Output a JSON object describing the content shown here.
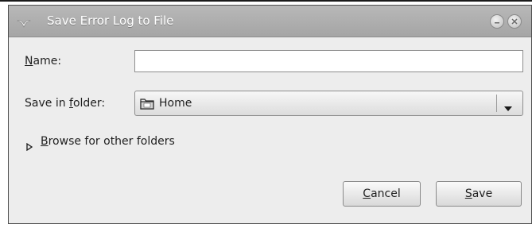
{
  "window": {
    "title": "Save Error Log to File",
    "icons": {
      "app": "seagull-icon",
      "minimize": "minimize-icon",
      "close": "close-icon"
    }
  },
  "form": {
    "name": {
      "label_accel": "N",
      "label_rest": "ame:",
      "value": ""
    },
    "folder": {
      "label_pre": "Save in ",
      "label_accel": "f",
      "label_rest": "older:",
      "selected": "Home",
      "icon": "folder-icon"
    },
    "browse": {
      "accel": "B",
      "rest": "rowse for other folders"
    }
  },
  "buttons": {
    "cancel": {
      "accel": "C",
      "rest": "ancel"
    },
    "save": {
      "accel": "S",
      "rest": "ave"
    }
  },
  "colors": {
    "titlebar": "#aeaeae",
    "dialog_bg": "#ededed",
    "title_text": "#ffffff"
  }
}
